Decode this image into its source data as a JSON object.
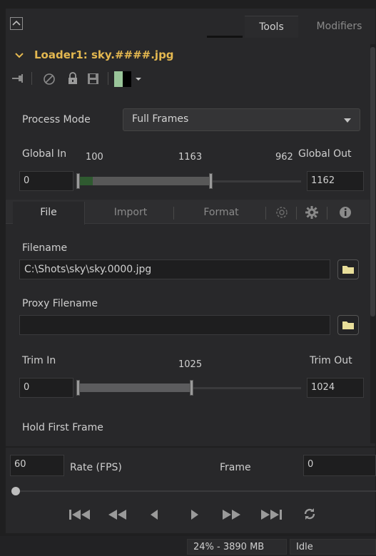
{
  "header": {
    "tabs": [
      {
        "label": "Tools",
        "active": true
      },
      {
        "label": "Modifiers",
        "active": false
      }
    ]
  },
  "loader": {
    "title": "Loader1: sky.####.jpg",
    "swatch_colors": [
      "#9ac59a",
      "#000000"
    ]
  },
  "process_mode": {
    "label": "Process Mode",
    "value": "Full Frames"
  },
  "global_range": {
    "label_in": "Global In",
    "label_out": "Global Out",
    "tick_left": "100",
    "tick_mid": "1163",
    "tick_right": "962",
    "in_value": "0",
    "out_value": "1162"
  },
  "subtabs": [
    {
      "label": "File",
      "active": true
    },
    {
      "label": "Import",
      "active": false
    },
    {
      "label": "Format",
      "active": false
    }
  ],
  "file": {
    "filename_label": "Filename",
    "filename_value": "C:\\Shots\\sky\\sky.0000.jpg",
    "proxy_label": "Proxy Filename",
    "proxy_value": ""
  },
  "trim": {
    "label_in": "Trim In",
    "label_out": "Trim Out",
    "tick_mid": "1025",
    "in_value": "0",
    "out_value": "1024"
  },
  "hold_first_frame": {
    "label": "Hold First Frame"
  },
  "playback": {
    "rate_value": "60",
    "rate_label": "Rate (FPS)",
    "frame_label": "Frame",
    "frame_value": "0",
    "position": 0
  },
  "status": {
    "memory": "24% - 3890 MB",
    "state": "Idle"
  },
  "colors": {
    "accent_title": "#e4b850",
    "folder": "#e8de9a",
    "range_fill": "#2f5a30"
  }
}
